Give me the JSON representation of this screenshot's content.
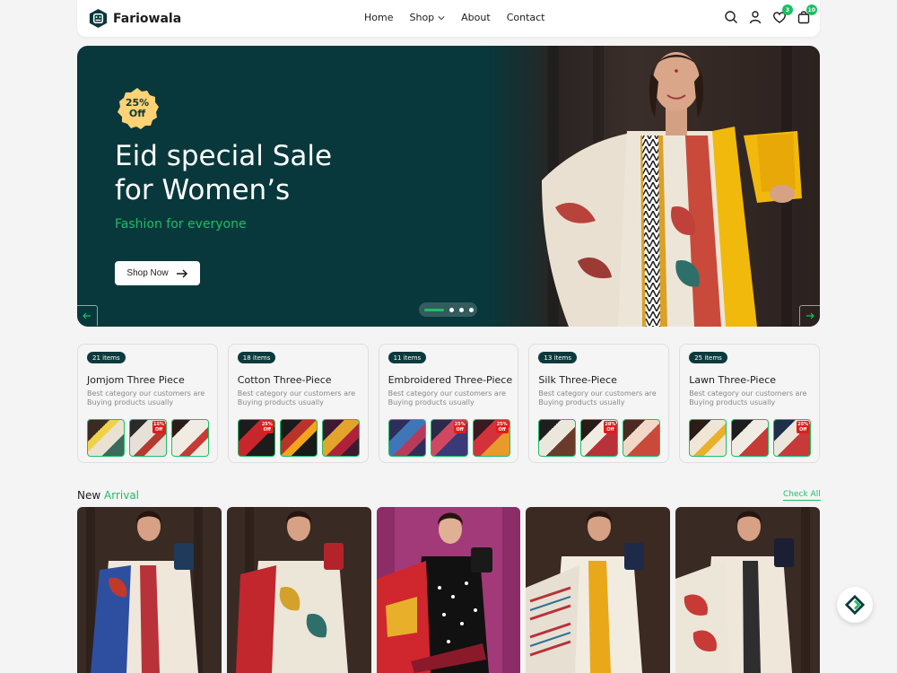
{
  "brand": {
    "name": "Fariowala",
    "accent": "#1dbe65",
    "dark": "#08383b"
  },
  "nav": {
    "items": [
      {
        "label": "Home"
      },
      {
        "label": "Shop"
      },
      {
        "label": "About"
      },
      {
        "label": "Contact"
      }
    ]
  },
  "header_icons": {
    "search": "search-icon",
    "account": "user-icon",
    "wishlist": "heart-icon",
    "wishlist_count": "3",
    "cart": "bag-icon",
    "cart_count": "10"
  },
  "hero": {
    "discount_line1": "25%",
    "discount_line2": "Off",
    "title": "Eid special Sale\nfor Women’s",
    "subtitle": "Fashion for everyone",
    "cta": "Shop Now"
  },
  "categories": [
    {
      "count": "21 items",
      "title": "Jomjom Three Piece",
      "desc": "Best category our customers are Buying products usually",
      "thumb_offs": [
        "",
        "15%\nOff",
        ""
      ]
    },
    {
      "count": "18 items",
      "title": "Cotton Three-Piece",
      "desc": "Best category our customers are Buying products usually",
      "thumb_offs": [
        "25%\nOff",
        "",
        ""
      ]
    },
    {
      "count": "11 items",
      "title": "Embroidered Three-Piece",
      "desc": "Best category our customers are Buying products usually",
      "thumb_offs": [
        "",
        "25%\nOff",
        "25%\nOff"
      ]
    },
    {
      "count": "13 items",
      "title": "Silk Three-Piece",
      "desc": "Best category our customers are Buying products usually",
      "thumb_offs": [
        "",
        "28%\nOff",
        ""
      ]
    },
    {
      "count": "25 items",
      "title": "Lawn Three-Piece",
      "desc": "Best category our customers are Buying products usually",
      "thumb_offs": [
        "",
        "",
        "25%\nOff"
      ]
    }
  ],
  "new_arrival": {
    "title_part1": "New",
    "title_part2": "Arrival",
    "check_all": "Check All"
  }
}
